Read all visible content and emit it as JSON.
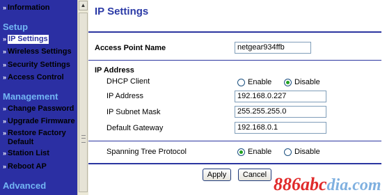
{
  "sidebar": {
    "items_top": [
      {
        "label": "Information"
      }
    ],
    "sections": [
      {
        "title": "Setup",
        "items": [
          {
            "label": "IP Settings",
            "selected": true
          },
          {
            "label": "Wireless Settings"
          },
          {
            "label": "Security Settings"
          },
          {
            "label": "Access Control"
          }
        ]
      },
      {
        "title": "Management",
        "items": [
          {
            "label": "Change Password"
          },
          {
            "label": "Upgrade Firmware"
          },
          {
            "label": "Restore Factory Default"
          },
          {
            "label": "Station List"
          },
          {
            "label": "Reboot AP"
          }
        ]
      },
      {
        "title": "Advanced",
        "items": []
      }
    ],
    "bullet_char": "»"
  },
  "scrollbar": {
    "up_arrow": "▲"
  },
  "main": {
    "title": "IP Settings",
    "access_point_name": {
      "label": "Access Point Name",
      "value": "netgear934ffb"
    },
    "ip_address_section": {
      "heading": "IP Address",
      "dhcp_client": {
        "label": "DHCP Client",
        "options": [
          "Enable",
          "Disable"
        ],
        "selected": "Disable"
      },
      "ip_address": {
        "label": "IP Address",
        "value": "192.168.0.227"
      },
      "subnet_mask": {
        "label": "IP Subnet Mask",
        "value": "255.255.255.0"
      },
      "default_gateway": {
        "label": "Default Gateway",
        "value": "192.168.0.1"
      }
    },
    "spanning_tree": {
      "label": "Spanning Tree Protocol",
      "options": [
        "Enable",
        "Disable"
      ],
      "selected": "Enable"
    },
    "buttons": {
      "apply": "Apply",
      "cancel": "Cancel"
    }
  },
  "watermark": {
    "text_main": "886abc",
    "text_tail": "dia.com"
  },
  "colors": {
    "sidebar_bg": "#2b2fa3",
    "section_title": "#73b6f4",
    "title_blue": "#2b3aa6",
    "radio_checked": "#21a121"
  }
}
